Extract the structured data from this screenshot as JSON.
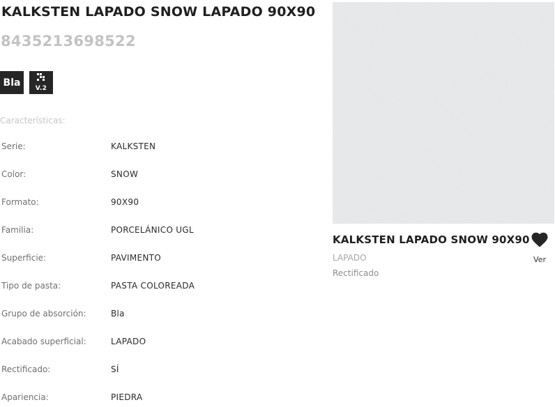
{
  "product": {
    "title": "KALKSTEN LAPADO SNOW LAPADO 90X90",
    "ean": "8435213698522"
  },
  "badges": {
    "absorption_label": "Bla",
    "version_label": "V.2",
    "version_icon": "qr-grid-icon"
  },
  "specs": {
    "heading": "Características:",
    "rows": [
      {
        "label": "Serie:",
        "value": "KALKSTEN"
      },
      {
        "label": "Color:",
        "value": "SNOW"
      },
      {
        "label": "Formato:",
        "value": "90X90"
      },
      {
        "label": "Familia:",
        "value": "PORCELÁNICO UGL"
      },
      {
        "label": "Superficie:",
        "value": "PAVIMENTO"
      },
      {
        "label": "Tipo de pasta:",
        "value": "PASTA COLOREADA"
      },
      {
        "label": "Grupo de absorción:",
        "value": "Bla"
      },
      {
        "label": "Acabado superficial:",
        "value": "LAPADO"
      },
      {
        "label": "Rectificado:",
        "value": "SÍ"
      },
      {
        "label": "Apariencia:",
        "value": "PIEDRA"
      }
    ]
  },
  "card": {
    "title": "KALKSTEN LAPADO SNOW 90X90",
    "finish": "LAPADO",
    "edge": "Rectificado",
    "fav_label": "Ver",
    "fav_icon": "heart-icon",
    "tile_color": "#e9eaeb"
  },
  "colors": {
    "text_dark": "#1f1f1f",
    "text_muted": "#c3c3c3",
    "badge_bg": "#262626"
  }
}
